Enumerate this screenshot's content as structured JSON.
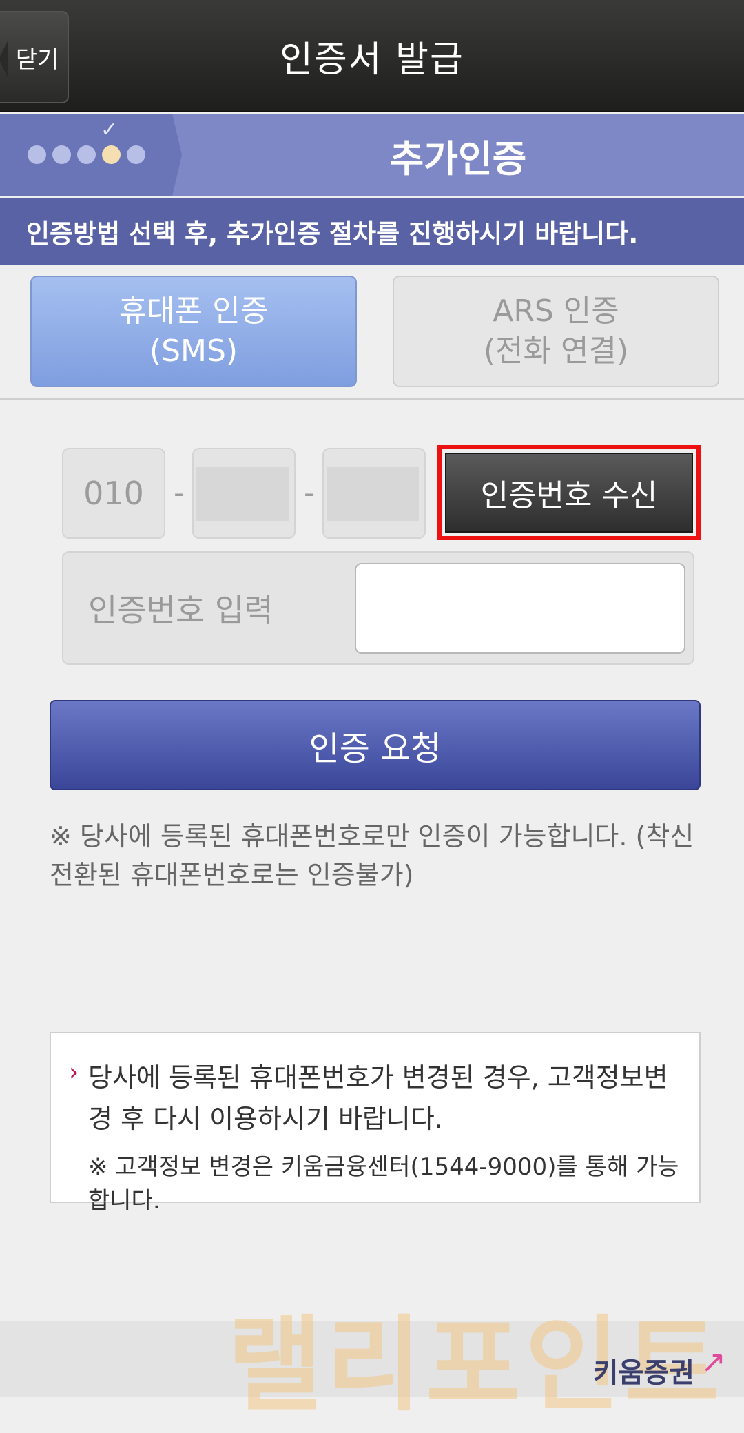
{
  "header": {
    "close_label": "닫기",
    "title": "인증서 발급"
  },
  "steps": {
    "check_icon": "✓",
    "title": "추가인증",
    "active_step": 4,
    "total_steps": 5
  },
  "info_strip": "인증방법 선택 후, 추가인증 절차를 진행하시기 바랍니다.",
  "tabs": [
    {
      "line1": "휴대폰 인증",
      "line2": "(SMS)",
      "selected": true
    },
    {
      "line1": "ARS 인증",
      "line2": "(전화 연결)",
      "selected": false
    }
  ],
  "phone": {
    "prefix": "010",
    "separator": "-",
    "receive_button": "인증번호 수신"
  },
  "code": {
    "label": "인증번호 입력",
    "value": ""
  },
  "request_button": "인증 요청",
  "notice": "※ 당사에 등록된 휴대폰번호로만 인증이 가능합니다. (착신전환된 휴대폰번호로는 인증불가)",
  "infobox": {
    "arrow": "›",
    "line1": "당사에 등록된 휴대폰번호가 변경된 경우, 고객정보변경 후 다시 이용하시기 바랍니다.",
    "line2": "※ 고객정보 변경은 키움금융센터(1544-9000)를 통해 가능합니다."
  },
  "footer": {
    "logo_text": "키움증권",
    "logo_arrow": "↗",
    "watermark": "랠리포인트"
  },
  "colors": {
    "highlight": "#ee1111",
    "accent": "#5a62a6"
  }
}
